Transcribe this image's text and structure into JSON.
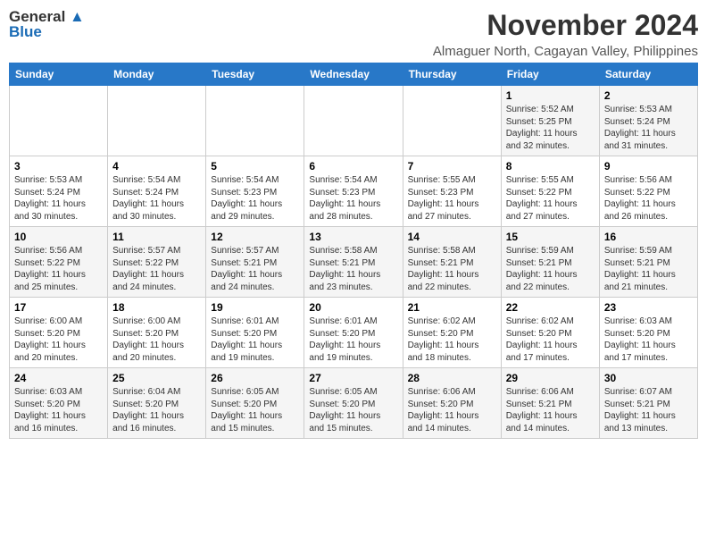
{
  "header": {
    "logo_line1": "General",
    "logo_line2": "Blue",
    "month_title": "November 2024",
    "location": "Almaguer North, Cagayan Valley, Philippines"
  },
  "weekdays": [
    "Sunday",
    "Monday",
    "Tuesday",
    "Wednesday",
    "Thursday",
    "Friday",
    "Saturday"
  ],
  "weeks": [
    [
      {
        "day": "",
        "info": ""
      },
      {
        "day": "",
        "info": ""
      },
      {
        "day": "",
        "info": ""
      },
      {
        "day": "",
        "info": ""
      },
      {
        "day": "",
        "info": ""
      },
      {
        "day": "1",
        "info": "Sunrise: 5:52 AM\nSunset: 5:25 PM\nDaylight: 11 hours and 32 minutes."
      },
      {
        "day": "2",
        "info": "Sunrise: 5:53 AM\nSunset: 5:24 PM\nDaylight: 11 hours and 31 minutes."
      }
    ],
    [
      {
        "day": "3",
        "info": "Sunrise: 5:53 AM\nSunset: 5:24 PM\nDaylight: 11 hours and 30 minutes."
      },
      {
        "day": "4",
        "info": "Sunrise: 5:54 AM\nSunset: 5:24 PM\nDaylight: 11 hours and 30 minutes."
      },
      {
        "day": "5",
        "info": "Sunrise: 5:54 AM\nSunset: 5:23 PM\nDaylight: 11 hours and 29 minutes."
      },
      {
        "day": "6",
        "info": "Sunrise: 5:54 AM\nSunset: 5:23 PM\nDaylight: 11 hours and 28 minutes."
      },
      {
        "day": "7",
        "info": "Sunrise: 5:55 AM\nSunset: 5:23 PM\nDaylight: 11 hours and 27 minutes."
      },
      {
        "day": "8",
        "info": "Sunrise: 5:55 AM\nSunset: 5:22 PM\nDaylight: 11 hours and 27 minutes."
      },
      {
        "day": "9",
        "info": "Sunrise: 5:56 AM\nSunset: 5:22 PM\nDaylight: 11 hours and 26 minutes."
      }
    ],
    [
      {
        "day": "10",
        "info": "Sunrise: 5:56 AM\nSunset: 5:22 PM\nDaylight: 11 hours and 25 minutes."
      },
      {
        "day": "11",
        "info": "Sunrise: 5:57 AM\nSunset: 5:22 PM\nDaylight: 11 hours and 24 minutes."
      },
      {
        "day": "12",
        "info": "Sunrise: 5:57 AM\nSunset: 5:21 PM\nDaylight: 11 hours and 24 minutes."
      },
      {
        "day": "13",
        "info": "Sunrise: 5:58 AM\nSunset: 5:21 PM\nDaylight: 11 hours and 23 minutes."
      },
      {
        "day": "14",
        "info": "Sunrise: 5:58 AM\nSunset: 5:21 PM\nDaylight: 11 hours and 22 minutes."
      },
      {
        "day": "15",
        "info": "Sunrise: 5:59 AM\nSunset: 5:21 PM\nDaylight: 11 hours and 22 minutes."
      },
      {
        "day": "16",
        "info": "Sunrise: 5:59 AM\nSunset: 5:21 PM\nDaylight: 11 hours and 21 minutes."
      }
    ],
    [
      {
        "day": "17",
        "info": "Sunrise: 6:00 AM\nSunset: 5:20 PM\nDaylight: 11 hours and 20 minutes."
      },
      {
        "day": "18",
        "info": "Sunrise: 6:00 AM\nSunset: 5:20 PM\nDaylight: 11 hours and 20 minutes."
      },
      {
        "day": "19",
        "info": "Sunrise: 6:01 AM\nSunset: 5:20 PM\nDaylight: 11 hours and 19 minutes."
      },
      {
        "day": "20",
        "info": "Sunrise: 6:01 AM\nSunset: 5:20 PM\nDaylight: 11 hours and 19 minutes."
      },
      {
        "day": "21",
        "info": "Sunrise: 6:02 AM\nSunset: 5:20 PM\nDaylight: 11 hours and 18 minutes."
      },
      {
        "day": "22",
        "info": "Sunrise: 6:02 AM\nSunset: 5:20 PM\nDaylight: 11 hours and 17 minutes."
      },
      {
        "day": "23",
        "info": "Sunrise: 6:03 AM\nSunset: 5:20 PM\nDaylight: 11 hours and 17 minutes."
      }
    ],
    [
      {
        "day": "24",
        "info": "Sunrise: 6:03 AM\nSunset: 5:20 PM\nDaylight: 11 hours and 16 minutes."
      },
      {
        "day": "25",
        "info": "Sunrise: 6:04 AM\nSunset: 5:20 PM\nDaylight: 11 hours and 16 minutes."
      },
      {
        "day": "26",
        "info": "Sunrise: 6:05 AM\nSunset: 5:20 PM\nDaylight: 11 hours and 15 minutes."
      },
      {
        "day": "27",
        "info": "Sunrise: 6:05 AM\nSunset: 5:20 PM\nDaylight: 11 hours and 15 minutes."
      },
      {
        "day": "28",
        "info": "Sunrise: 6:06 AM\nSunset: 5:20 PM\nDaylight: 11 hours and 14 minutes."
      },
      {
        "day": "29",
        "info": "Sunrise: 6:06 AM\nSunset: 5:21 PM\nDaylight: 11 hours and 14 minutes."
      },
      {
        "day": "30",
        "info": "Sunrise: 6:07 AM\nSunset: 5:21 PM\nDaylight: 11 hours and 13 minutes."
      }
    ]
  ]
}
